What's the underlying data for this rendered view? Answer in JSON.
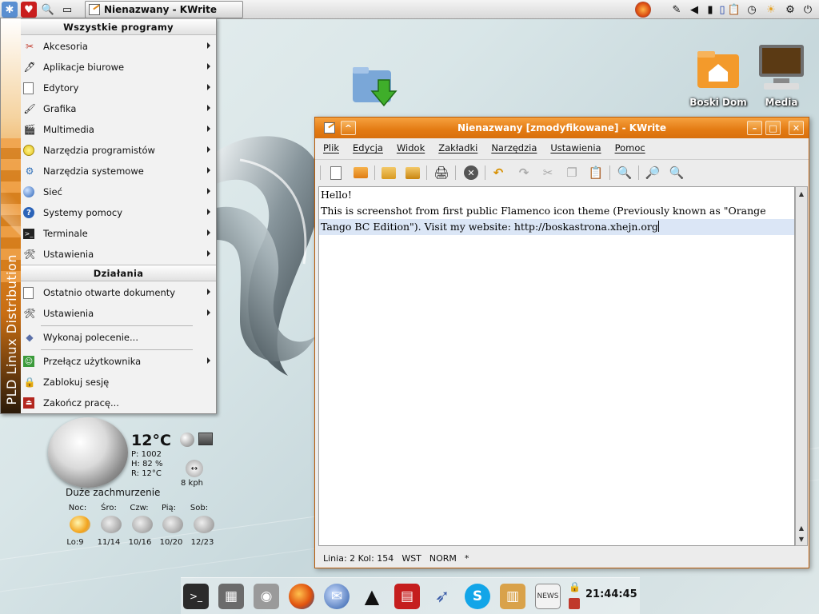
{
  "top_panel": {
    "task_title": "Nienazwany - KWrite",
    "launcher_icons": [
      "kmenu-icon",
      "favorites-icon",
      "search-icon",
      "show-desktop-icon"
    ],
    "tray_icons": [
      "firefox-icon",
      "edit-icon",
      "volume-icon",
      "battery-icon",
      "network-icon",
      "clipboard-icon",
      "clock-icon",
      "weather-icon",
      "kde-icon"
    ]
  },
  "kmenu": {
    "side_text": "PLD Linux Distribution",
    "all_programs_header": "Wszystkie programy",
    "programs": [
      {
        "label": "Akcesoria",
        "icon": "accessories-icon"
      },
      {
        "label": "Aplikacje biurowe",
        "icon": "office-icon"
      },
      {
        "label": "Edytory",
        "icon": "editors-icon"
      },
      {
        "label": "Grafika",
        "icon": "graphics-icon"
      },
      {
        "label": "Multimedia",
        "icon": "multimedia-icon"
      },
      {
        "label": "Narzędzia programistów",
        "icon": "development-icon"
      },
      {
        "label": "Narzędzia systemowe",
        "icon": "system-tools-icon"
      },
      {
        "label": "Sieć",
        "icon": "network-icon"
      },
      {
        "label": "Systemy pomocy",
        "icon": "help-icon"
      },
      {
        "label": "Terminale",
        "icon": "terminal-icon"
      },
      {
        "label": "Ustawienia",
        "icon": "settings-icon"
      }
    ],
    "actions_header": "Działania",
    "actions": [
      {
        "label": "Ostatnio otwarte dokumenty",
        "icon": "recent-documents-icon"
      },
      {
        "label": "Ustawienia",
        "icon": "settings-icon"
      },
      {
        "label": "Wykonaj polecenie...",
        "icon": "run-command-icon"
      },
      {
        "label": "Przełącz użytkownika",
        "icon": "switch-user-icon"
      },
      {
        "label": "Zablokuj sesję",
        "icon": "lock-icon"
      },
      {
        "label": "Zakończ pracę...",
        "icon": "logout-icon"
      }
    ]
  },
  "weather": {
    "temperature": "12°C",
    "pressure": "P: 1002",
    "humidity": "H: 82 %",
    "realfeel": "R: 12°C",
    "wind": "8 kph",
    "condition": "Duże zachmurzenie",
    "forecast": [
      {
        "day": "Noc:",
        "temps": "Lo:9",
        "icon": "moon-cloud-icon"
      },
      {
        "day": "Śro:",
        "temps": "11/14",
        "icon": "rain-cloud-icon"
      },
      {
        "day": "Czw:",
        "temps": "10/16",
        "icon": "rain-cloud-icon"
      },
      {
        "day": "Pią:",
        "temps": "10/20",
        "icon": "rain-cloud-icon"
      },
      {
        "day": "Sob:",
        "temps": "12/23",
        "icon": "rain-cloud-icon"
      }
    ]
  },
  "desktop_icons": [
    {
      "label": "Boski Dom",
      "icon": "home-folder-icon"
    },
    {
      "label": "Media",
      "icon": "media-computer-icon"
    }
  ],
  "kwrite": {
    "title": "Nienazwany [zmodyfikowane] - KWrite",
    "menu": [
      "Plik",
      "Edycja",
      "Widok",
      "Zakładki",
      "Narzędzia",
      "Ustawienia",
      "Pomoc"
    ],
    "toolbar": [
      "new-document-icon",
      "open-icon",
      "save-icon",
      "save-as-icon",
      "print-icon",
      "close-icon",
      "undo-icon",
      "redo-icon",
      "cut-icon",
      "copy-icon",
      "paste-icon",
      "find-icon",
      "zoom-in-icon",
      "zoom-out-icon"
    ],
    "lines": [
      "Hello!",
      "This is screenshot from first public Flamenco  icon theme (Previously known as \"Orange",
      "Tango BC Edition\"). Visit my website: http://boskastrona.xhejn.org"
    ],
    "status": {
      "position": "Linia: 2 Kol: 154",
      "insert_mode": "WST",
      "selection_mode": "NORM",
      "modified": "*"
    }
  },
  "dock": {
    "icons": [
      "terminal-icon",
      "calculator-icon",
      "screenshot-icon",
      "firefox-icon",
      "thunderbird-icon",
      "inkscape-icon",
      "office-icon",
      "xine-icon",
      "skype-icon",
      "map-icon",
      "news-icon"
    ],
    "clock": "21:44:45"
  }
}
